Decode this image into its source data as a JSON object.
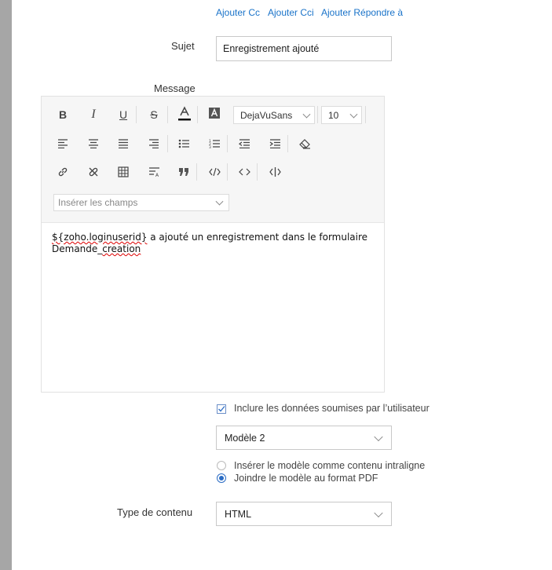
{
  "header_links": [
    "Ajouter Cc",
    "Ajouter Cci",
    "Ajouter Répondre à"
  ],
  "subject": {
    "label": "Sujet",
    "value": "Enregistrement ajouté"
  },
  "message": {
    "label": "Message",
    "font_family": "DejaVuSans",
    "font_size": "10",
    "insert_fields_placeholder": "Insérer les champs",
    "body_line1_token": "${zoho.loginuserid}",
    "body_line1_rest": " a ajouté un enregistrement dans le formulaire",
    "body_line2_prefix": "Demande",
    "body_line2_underscore": "_",
    "body_line2_word": "creation"
  },
  "include_submitted": {
    "label": "Inclure les données soumises par l’utilisateur",
    "checked": true
  },
  "template": {
    "value": "Modèle 2"
  },
  "template_mode": {
    "options": [
      "Insérer le modèle comme contenu intraligne",
      "Joindre le modèle au format PDF"
    ],
    "selected": 1
  },
  "content_type": {
    "label": "Type de contenu",
    "value": "HTML"
  },
  "colors": {
    "link": "#1a73c9",
    "accent": "#2b6cc4",
    "strip": "#a6a6a6"
  },
  "toolbar_icons": [
    "bold-icon",
    "italic-icon",
    "underline-icon",
    "strikethrough-icon",
    "text-color-icon",
    "background-color-icon",
    "align-left-icon",
    "align-center-icon",
    "align-justify-icon",
    "align-right-icon",
    "bulleted-list-icon",
    "numbered-list-icon",
    "decrease-indent-icon",
    "increase-indent-icon",
    "clear-format-icon",
    "link-icon",
    "unlink-icon",
    "table-icon",
    "line-height-icon",
    "quote-icon",
    "code-icon",
    "source-code-icon",
    "embed-icon"
  ]
}
